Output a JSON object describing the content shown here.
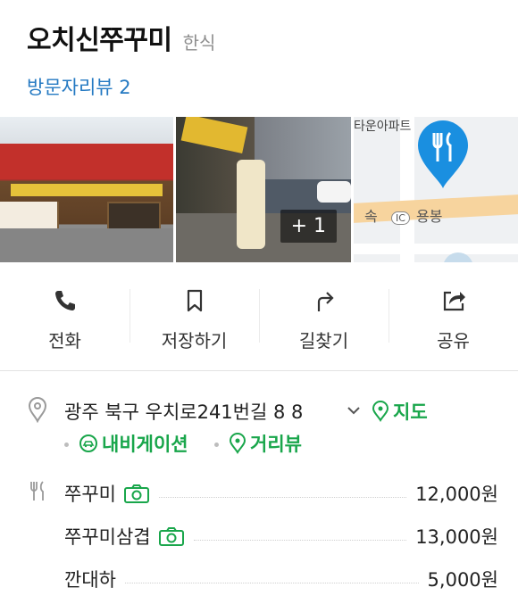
{
  "place": {
    "name": "오치신쭈꾸미",
    "category": "한식",
    "review_link": "방문자리뷰 2"
  },
  "photos": {
    "more_count": "+ 1",
    "map_label_top": "타운아파트",
    "map_ic_badge": "IC",
    "map_road_label": "속",
    "map_area_label": "용봉",
    "pin_color": "#1a8fe0"
  },
  "actions": [
    {
      "icon": "phone-icon",
      "label": "전화"
    },
    {
      "icon": "bookmark-icon",
      "label": "저장하기"
    },
    {
      "icon": "directions-icon",
      "label": "길찾기"
    },
    {
      "icon": "share-icon",
      "label": "공유"
    }
  ],
  "address": {
    "text": "광주 북구 우치로241번길 8 8",
    "map_link": "지도",
    "navigation_link": "내비게이션",
    "street_view_link": "거리뷰"
  },
  "menu": [
    {
      "name": "쭈꾸미",
      "has_photo": true,
      "price": "12,000원"
    },
    {
      "name": "쭈꾸미삼겹",
      "has_photo": true,
      "price": "13,000원"
    },
    {
      "name": "깐대하",
      "has_photo": false,
      "price": "5,000원"
    }
  ],
  "colors": {
    "link_blue": "#2479c2",
    "green": "#19a64b",
    "accent_pin": "#1a8fe0"
  }
}
